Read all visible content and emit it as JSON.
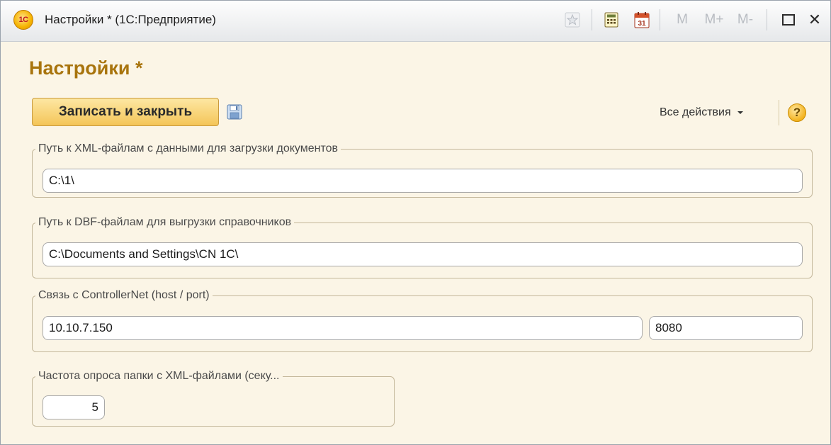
{
  "window": {
    "title": "Настройки * (1С:Предприятие)",
    "logo_text": "1С",
    "toolbar": {
      "favorite_icon": "star-icon",
      "calculator_icon": "calculator-icon",
      "calendar_icon": "calendar-icon",
      "calendar_day": "31",
      "m_label": "M",
      "m_plus_label": "M+",
      "m_minus_label": "M-",
      "maximize_icon": "maximize-icon",
      "close_label": "✕"
    }
  },
  "form": {
    "title": "Настройки *",
    "save_close_label": "Записать и закрыть",
    "save_icon": "floppy-disk-icon",
    "all_actions_label": "Все действия",
    "help_label": "?"
  },
  "groups": {
    "xml_path": {
      "legend": "Путь к XML-файлам с данными для загрузки документов",
      "value": "C:\\1\\"
    },
    "dbf_path": {
      "legend": "Путь к DBF-файлам для выгрузки справочников",
      "value": "C:\\Documents and Settings\\CN 1C\\"
    },
    "controller": {
      "legend": "Связь с ControllerNet (host / port)",
      "host": "10.10.7.150",
      "port": "8080"
    },
    "poll": {
      "legend": "Частота опроса папки с XML-файлами (секу...",
      "value": "5"
    }
  },
  "colors": {
    "title_color": "#a8740d",
    "form_background": "#fbf5e6",
    "button_gradient_top": "#fde7a3",
    "button_gradient_bottom": "#f4c558"
  }
}
